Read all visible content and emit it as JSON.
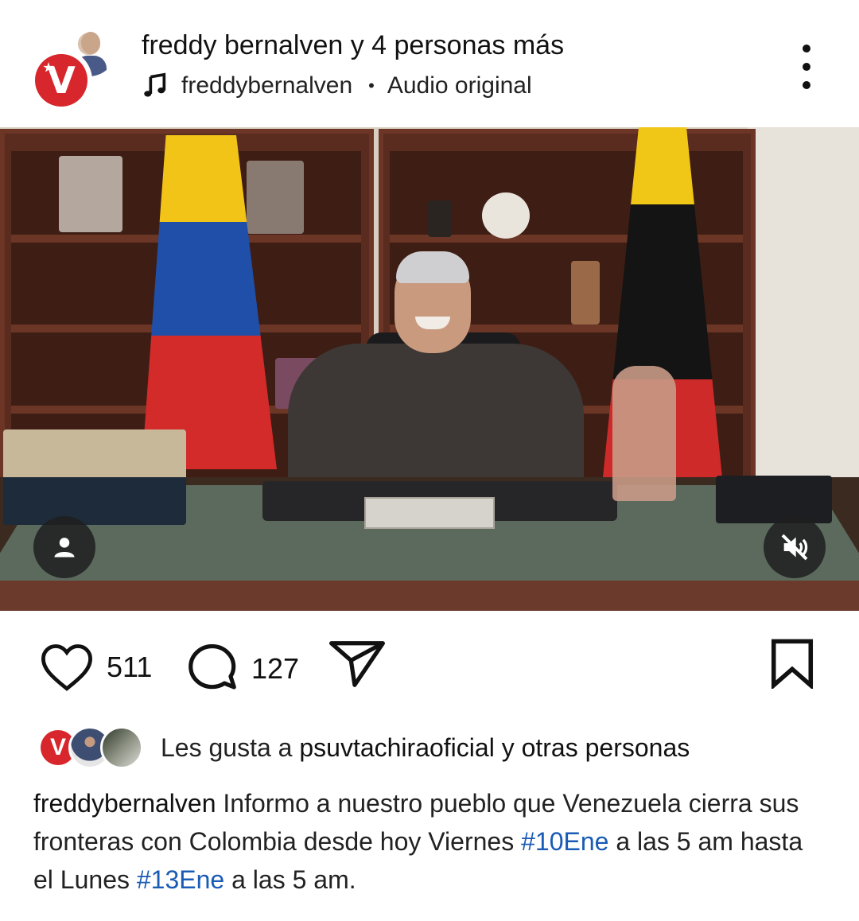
{
  "header": {
    "title": "freddy bernalven y 4 personas más",
    "audio_user": "freddybernalven",
    "separator": "•",
    "audio_label": "Audio original"
  },
  "media": {
    "profile_icon": "person-icon",
    "mute_icon": "muted-speaker-icon"
  },
  "actions": {
    "likes": "511",
    "comments": "127"
  },
  "liked_by": {
    "prefix": "Les gusta a",
    "user": "psuvtachiraoficial",
    "suffix": "y otras personas"
  },
  "caption": {
    "user": "freddybernalven",
    "text_1": " Informo a nuestro pueblo que Venezuela cierra sus fronteras con Colombia desde hoy Viernes ",
    "hashtag_1": "#10Ene",
    "text_2": " a las 5 am hasta el  Lunes ",
    "hashtag_2": "#13Ene",
    "text_3": " a las 5 am."
  },
  "colors": {
    "brand_red": "#d7262c",
    "hashtag_blue": "#1a5bb5"
  }
}
